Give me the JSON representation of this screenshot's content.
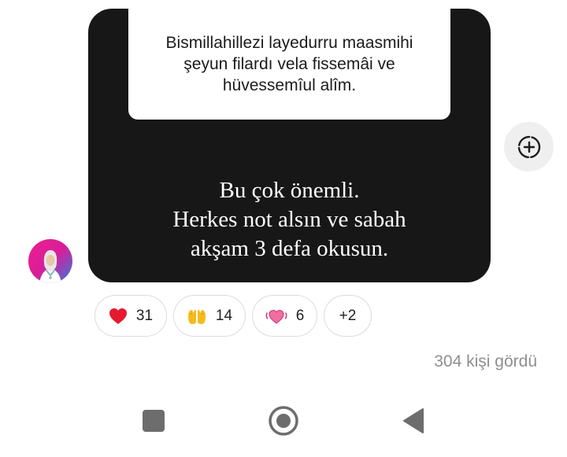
{
  "story": {
    "quote": "Bismillahillezi layedurru maasmihi\nşeyun filardı vela fissemâi ve\nhüvessemîul alîm.",
    "message": "Bu çok önemli.\nHerkes not alsın ve sabah\nakşam 3 defa okusun."
  },
  "reactions": [
    {
      "emoji": "red-heart",
      "count": "31"
    },
    {
      "emoji": "raising-hands",
      "count": "14"
    },
    {
      "emoji": "beating-heart",
      "count": "6"
    },
    {
      "more": "+2"
    }
  ],
  "seen_text": "304 kişi gördü",
  "icons": {
    "add_button": "circle-plus-dashed-icon",
    "avatar": "profile-avatar",
    "nav": [
      "square-recents-icon",
      "circle-home-icon",
      "triangle-back-icon"
    ]
  },
  "colors": {
    "story_background": "#171717",
    "heart_red": "#e6192f",
    "avatar_gradient": [
      "#ec1f8f",
      "#2f7ce0"
    ],
    "seen_text": "#8e8e8e",
    "nav_icons": "#6d6d6d"
  }
}
